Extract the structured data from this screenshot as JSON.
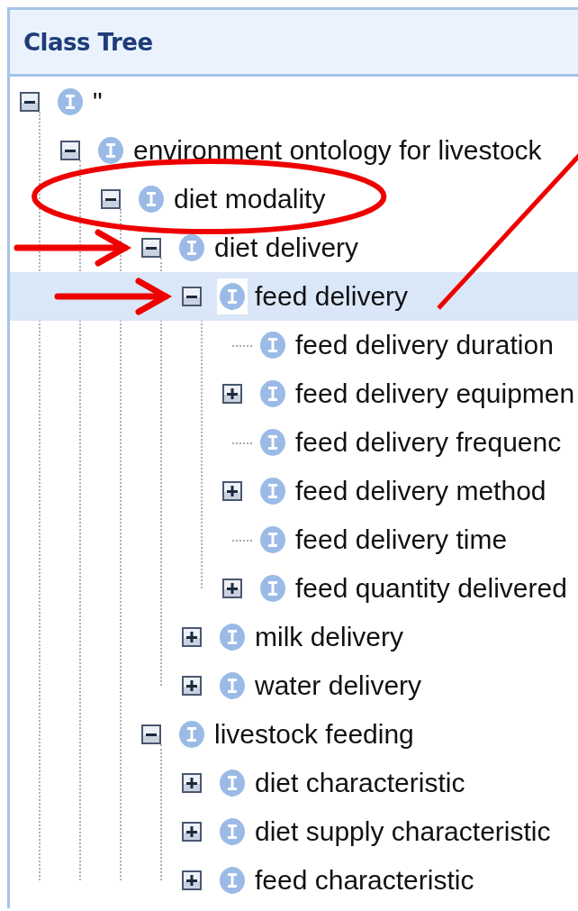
{
  "panel": {
    "title": "Class Tree"
  },
  "tree": [
    {
      "label": "\"",
      "kind": "branch",
      "expanded": true,
      "selected": false,
      "children": [
        {
          "label": "environment ontology for livestock",
          "kind": "branch",
          "expanded": true,
          "selected": false,
          "children": [
            {
              "label": "diet modality",
              "kind": "branch",
              "expanded": true,
              "selected": false,
              "annotations": [
                {
                  "kind": "ellipse"
                }
              ],
              "children": [
                {
                  "label": "diet delivery",
                  "kind": "branch",
                  "expanded": true,
                  "selected": false,
                  "annotations": [
                    {
                      "kind": "arrow"
                    }
                  ],
                  "children": [
                    {
                      "label": "feed delivery",
                      "kind": "branch",
                      "expanded": true,
                      "selected": true,
                      "annotations": [
                        {
                          "kind": "arrow",
                          "leader_line": true
                        }
                      ],
                      "children": [
                        {
                          "label": "feed delivery duration",
                          "kind": "leaf",
                          "selected": false
                        },
                        {
                          "label": "feed delivery equipmen",
                          "kind": "branch",
                          "expanded": false,
                          "selected": false
                        },
                        {
                          "label": "feed delivery frequenc",
                          "kind": "leaf",
                          "selected": false
                        },
                        {
                          "label": "feed delivery method",
                          "kind": "branch",
                          "expanded": false,
                          "selected": false
                        },
                        {
                          "label": "feed delivery time",
                          "kind": "leaf",
                          "selected": false
                        },
                        {
                          "label": "feed quantity delivered",
                          "kind": "branch",
                          "expanded": false,
                          "selected": false
                        }
                      ]
                    },
                    {
                      "label": "milk delivery",
                      "kind": "branch",
                      "expanded": false,
                      "selected": false
                    },
                    {
                      "label": "water delivery",
                      "kind": "branch",
                      "expanded": false,
                      "selected": false
                    }
                  ]
                },
                {
                  "label": "livestock feeding",
                  "kind": "branch",
                  "expanded": true,
                  "selected": false,
                  "children": [
                    {
                      "label": "diet characteristic",
                      "kind": "branch",
                      "expanded": false,
                      "selected": false
                    },
                    {
                      "label": "diet supply characteristic",
                      "kind": "branch",
                      "expanded": false,
                      "selected": false
                    },
                    {
                      "label": "feed characteristic",
                      "kind": "branch",
                      "expanded": false,
                      "selected": false
                    }
                  ]
                }
              ]
            }
          ]
        }
      ]
    }
  ]
}
